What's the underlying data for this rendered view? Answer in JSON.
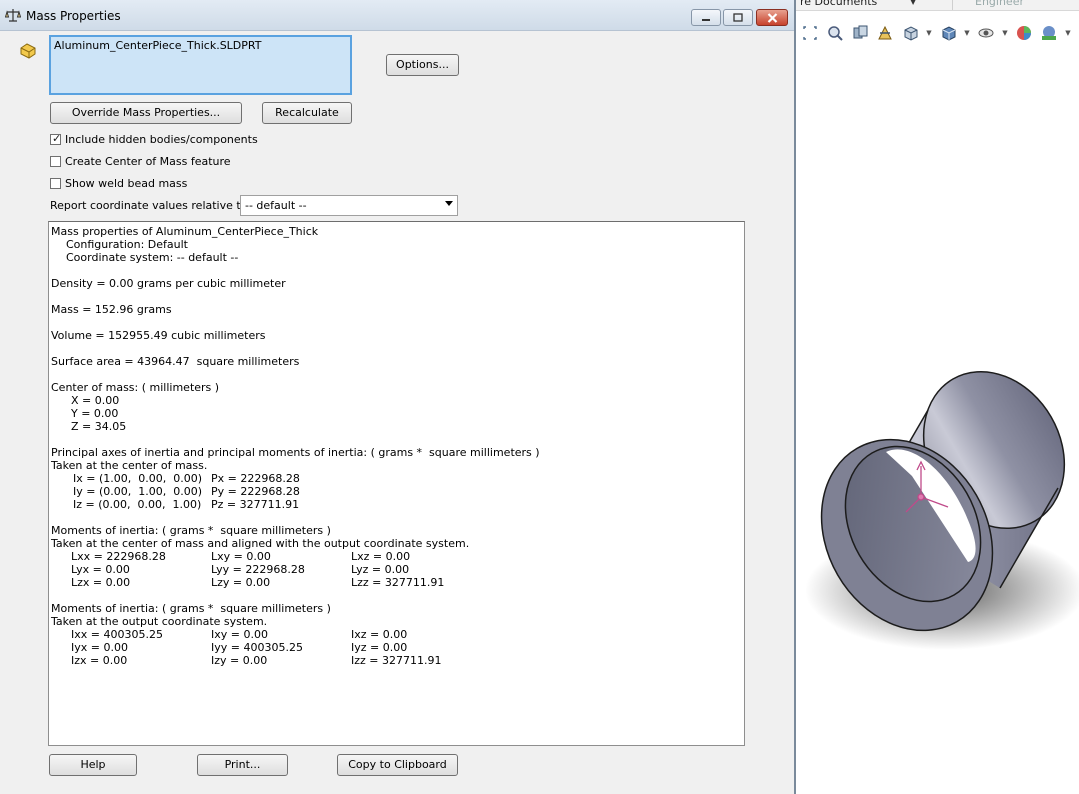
{
  "dialog": {
    "title": "Mass Properties",
    "file_item": "Aluminum_CenterPiece_Thick.SLDPRT",
    "buttons": {
      "options": "Options...",
      "override": "Override Mass Properties...",
      "recalculate": "Recalculate",
      "help": "Help",
      "print": "Print...",
      "copy": "Copy to Clipboard"
    },
    "checkboxes": [
      {
        "label": "Include hidden bodies/components",
        "checked": true
      },
      {
        "label": "Create Center of Mass feature",
        "checked": false
      },
      {
        "label": "Show weld bead mass",
        "checked": false
      }
    ],
    "report_label": "Report coordinate values relative to:",
    "report_value": "-- default --"
  },
  "results": {
    "header": "Mass properties of Aluminum_CenterPiece_Thick",
    "configuration": "Configuration: Default",
    "coord_system": "Coordinate system: -- default --",
    "density": "Density = 0.00 grams per cubic millimeter",
    "mass": "Mass = 152.96 grams",
    "volume": "Volume = 152955.49 cubic millimeters",
    "surface": "Surface area = 43964.47  square millimeters",
    "com_header": "Center of mass: ( millimeters )",
    "com_x": "X = 0.00",
    "com_y": "Y = 0.00",
    "com_z": "Z = 34.05",
    "principal_header": "Principal axes of inertia and principal moments of inertia: ( grams *  square millimeters )",
    "principal_taken": "Taken at the center of mass.",
    "ix": "Ix = (1.00,  0.00,  0.00)",
    "iy": "Iy = (0.00,  1.00,  0.00)",
    "iz": "Iz = (0.00,  0.00,  1.00)",
    "px": "Px = 222968.28",
    "py": "Py = 222968.28",
    "pz": "Pz = 327711.91",
    "moments1_header": "Moments of inertia: ( grams *  square millimeters )",
    "moments1_taken": "Taken at the center of mass and aligned with the output coordinate system.",
    "moments1": [
      [
        "Lxx = 222968.28",
        "Lxy = 0.00",
        "Lxz = 0.00"
      ],
      [
        "Lyx = 0.00",
        "Lyy = 222968.28",
        "Lyz = 0.00"
      ],
      [
        "Lzx = 0.00",
        "Lzy = 0.00",
        "Lzz = 327711.91"
      ]
    ],
    "moments2_header": "Moments of inertia: ( grams *  square millimeters )",
    "moments2_taken": "Taken at the output coordinate system.",
    "moments2": [
      [
        "Ixx = 400305.25",
        "Ixy = 0.00",
        "Ixz = 0.00"
      ],
      [
        "Iyx = 0.00",
        "Iyy = 400305.25",
        "Iyz = 0.00"
      ],
      [
        "Izx = 0.00",
        "Izy = 0.00",
        "Izz = 327711.91"
      ]
    ]
  },
  "background": {
    "doc_label": "re Documents",
    "user_label": "Engineer"
  },
  "colors": {
    "selection_fill": "#cde4f7",
    "selection_border": "#5aa2e0",
    "close_button": "#c7422c",
    "part_face": "#8f91a4"
  }
}
